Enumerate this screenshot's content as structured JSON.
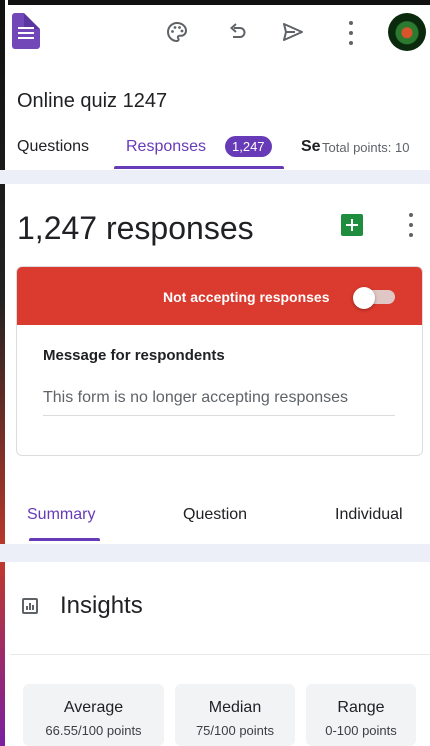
{
  "form": {
    "title": "Online quiz 1247"
  },
  "toolbar": {
    "icons": [
      "palette-icon",
      "undo-icon",
      "send-icon",
      "more-vert-icon"
    ]
  },
  "tabs": {
    "questions": "Questions",
    "responses": "Responses",
    "responses_badge": "1,247",
    "settings": "Se",
    "total_points": "Total points: 10"
  },
  "responses": {
    "count_label": "1,247 responses",
    "accepting_label": "Not accepting responses",
    "accepting": false,
    "message_label": "Message for respondents",
    "message_value": "This form is no longer accepting responses"
  },
  "summary_tabs": {
    "summary": "Summary",
    "question": "Question",
    "individual": "Individual"
  },
  "insights": {
    "title": "Insights",
    "stats": [
      {
        "label": "Average",
        "value": "66.55/100 points"
      },
      {
        "label": "Median",
        "value": "75/100 points"
      },
      {
        "label": "Range",
        "value": "0-100 points"
      }
    ]
  },
  "colors": {
    "accent": "#673ab7",
    "banner": "#db3a2e",
    "sheets": "#1e8e3e"
  }
}
